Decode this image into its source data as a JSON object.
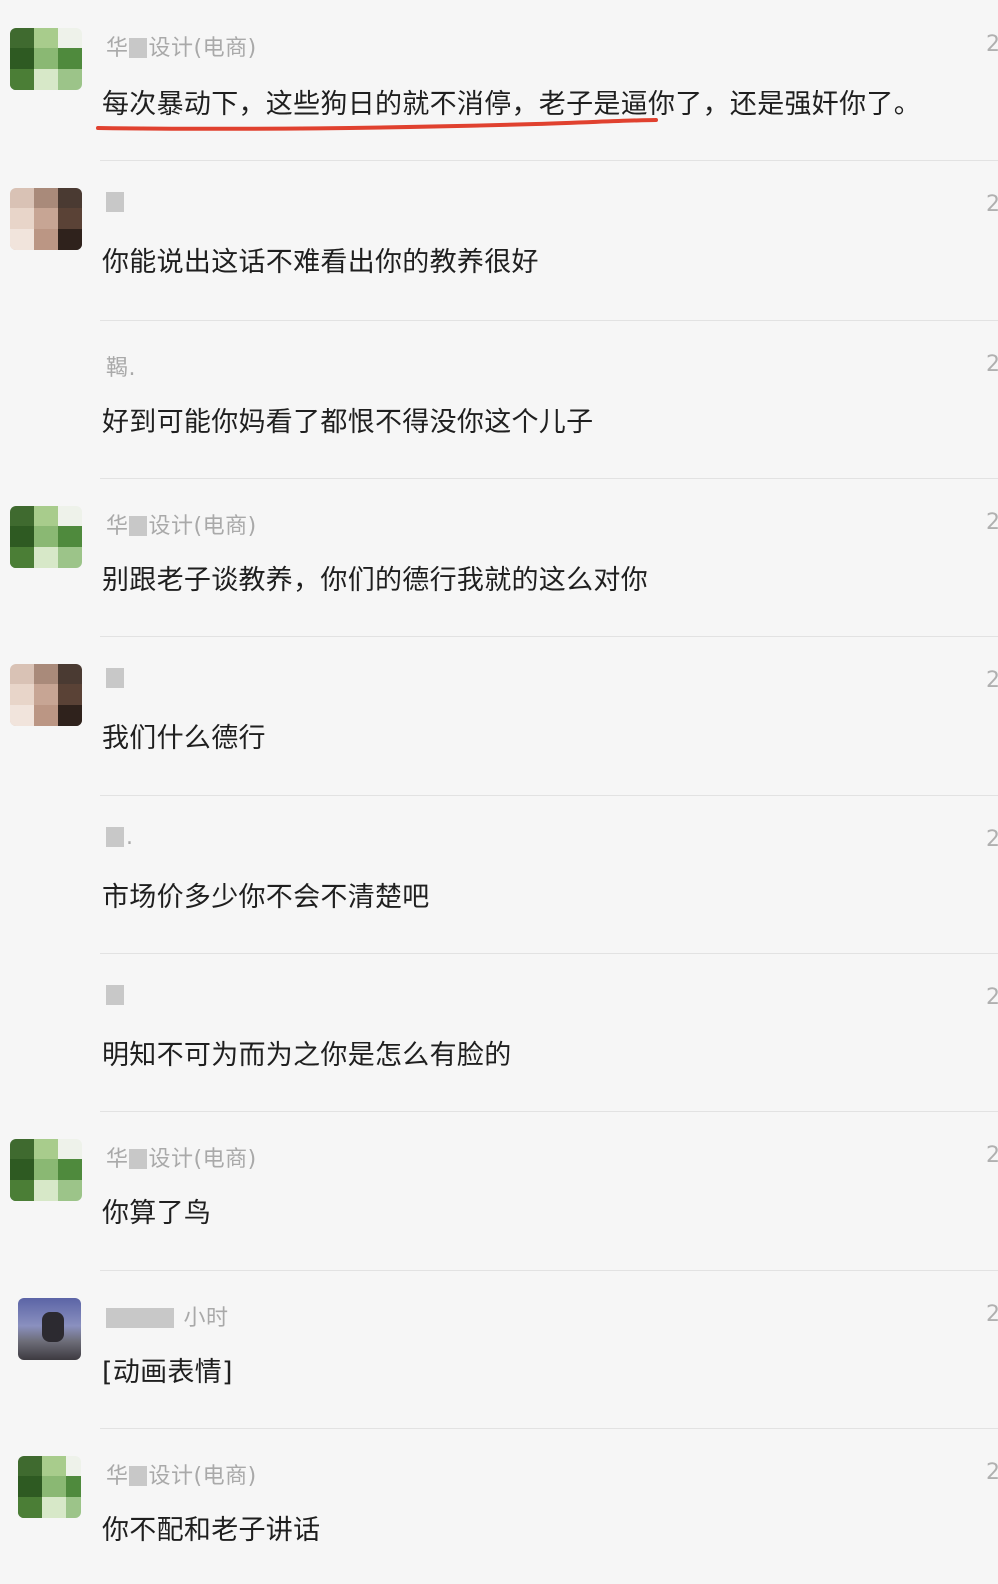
{
  "comments": [
    {
      "name_prefix": "华",
      "name_suffix": "设计(电商)",
      "time": "2",
      "text": "每次暴动下，这些狗日的就不消停，老子是逼你了，还是强奸你了。",
      "avatar": "blurred-green-avatar"
    },
    {
      "name_prefix": "",
      "name_suffix": "",
      "time": "2",
      "text": "你能说出这话不难看出你的教养很好",
      "avatar": "blurred-face-avatar"
    },
    {
      "name_prefix": "",
      "name_suffix": "鞨.",
      "time": "2",
      "text": "好到可能你妈看了都恨不得没你这个儿子",
      "avatar": ""
    },
    {
      "name_prefix": "华",
      "name_suffix": "设计(电商)",
      "time": "2",
      "text": "别跟老子谈教养，你们的德行我就的这么对你",
      "avatar": "blurred-green-avatar"
    },
    {
      "name_prefix": "",
      "name_suffix": "",
      "time": "2",
      "text": "我们什么德行",
      "avatar": "blurred-face-avatar"
    },
    {
      "name_prefix": "",
      "name_suffix": ".",
      "time": "2",
      "text": "市场价多少你不会不清楚吧",
      "avatar": ""
    },
    {
      "name_prefix": "",
      "name_suffix": "",
      "time": "2",
      "text": "明知不可为而为之你是怎么有脸的",
      "avatar": ""
    },
    {
      "name_prefix": "华",
      "name_suffix": "设计(电商)",
      "time": "2",
      "text": "你算了鸟",
      "avatar": "blurred-green-avatar"
    },
    {
      "name_prefix": "",
      "name_suffix": "小时",
      "time": "2",
      "text": "[动画表情]",
      "avatar": "blurred-blue-avatar"
    },
    {
      "name_prefix": "华",
      "name_suffix": "设计(电商)",
      "time": "2",
      "text": "你不配和老子讲话",
      "avatar": "blurred-green-avatar"
    }
  ],
  "colors": {
    "background": "#f6f6f6",
    "text": "#1f1f1f",
    "meta": "#a9a9a9",
    "highlight_underline": "#e0412f"
  }
}
